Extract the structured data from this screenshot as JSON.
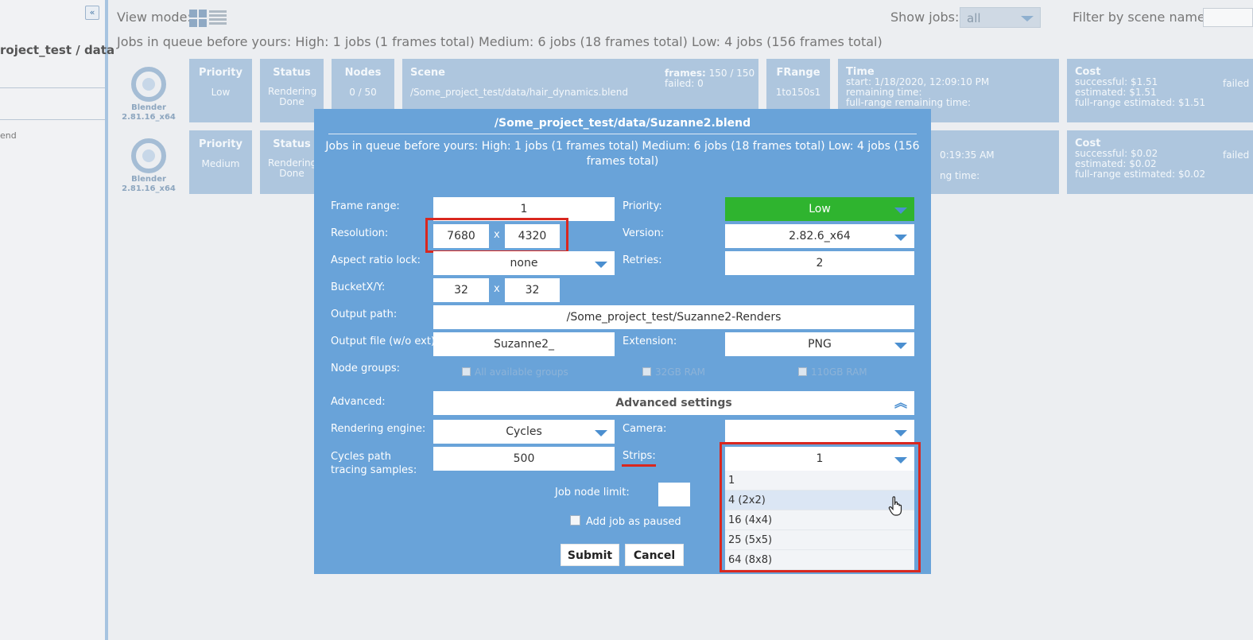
{
  "sidebar": {
    "collapse_glyph": "«",
    "breadcrumb": "roject_test / data",
    "end_text": "end"
  },
  "topbar": {
    "view_mode_label": "View mode:",
    "show_jobs_label": "Show jobs:",
    "show_jobs_value": "all",
    "filter_label": "Filter by scene name:",
    "filter_value": "",
    "queue_summary": "Jobs in queue before yours: High: 1 jobs (1 frames total)  Medium: 6 jobs (18 frames total)  Low: 4 jobs (156 frames total)"
  },
  "jobs": [
    {
      "app": "Blender",
      "app_version": "2.81.16_x64",
      "priority_label": "Priority",
      "priority": "Low",
      "status_label": "Status",
      "status": "Rendering Done",
      "nodes_label": "Nodes",
      "nodes": "0 / 50",
      "scene_label": "Scene",
      "scene": "/Some_project_test/data/hair_dynamics.blend",
      "frames_label": "frames:",
      "frames": "150 / 150",
      "failed_label": "failed:",
      "failed": "0",
      "frange_label": "FRange",
      "frange": "1to150s1",
      "time_label": "Time",
      "time_start": "start: 1/18/2020, 12:09:10 PM",
      "time_remaining": "remaining time:",
      "time_full": "full-range remaining time:",
      "cost_label": "Cost",
      "cost_successful": "successful: $1.51",
      "cost_estimated": "estimated: $1.51",
      "cost_full": "full-range estimated: $1.51",
      "cost_failed": "failed"
    },
    {
      "app": "Blender",
      "app_version": "2.81.16_x64",
      "priority_label": "Priority",
      "priority": "Medium",
      "status_label": "Status",
      "status": "Rendering Done",
      "time_partial_1": "0:19:35 AM",
      "time_partial_2": "ng time:",
      "cost_label": "Cost",
      "cost_successful": "successful: $0.02",
      "cost_estimated": "estimated: $0.02",
      "cost_full": "full-range estimated: $0.02",
      "cost_failed": "failed"
    }
  ],
  "modal": {
    "title": "/Some_project_test/data/Suzanne2.blend",
    "queue_text": "Jobs in queue before yours: High: 1 jobs (1 frames total)  Medium: 6 jobs (18 frames total)  Low: 4 jobs (156 frames total)",
    "frame_range_label": "Frame range:",
    "frame_range": "1",
    "resolution_label": "Resolution:",
    "res_x": "7680",
    "res_y": "4320",
    "x_sep": "x",
    "aspect_label": "Aspect ratio lock:",
    "aspect": "none",
    "bucket_label": "BucketX/Y:",
    "bucket_x": "32",
    "bucket_y": "32",
    "output_path_label": "Output path:",
    "output_path": "/Some_project_test/Suzanne2-Renders",
    "output_file_label": "Output file (w/o ext):",
    "output_file": "Suzanne2_",
    "node_groups_label": "Node groups:",
    "node_groups": [
      "All available groups",
      "32GB RAM",
      "110GB RAM"
    ],
    "advanced_label": "Advanced:",
    "advanced_button": "Advanced settings",
    "engine_label": "Rendering engine:",
    "engine": "Cycles",
    "samples_label": "Cycles path tracing samples:",
    "samples": "500",
    "job_node_limit_label": "Job node limit:",
    "job_node_limit": "",
    "add_paused_label": "Add job as paused",
    "priority_label": "Priority:",
    "priority": "Low",
    "priority_color": "#2fb42f",
    "version_label": "Version:",
    "version": "2.82.6_x64",
    "retries_label": "Retries:",
    "retries": "2",
    "extension_label": "Extension:",
    "extension": "PNG",
    "camera_label": "Camera:",
    "camera": "",
    "strips_label": "Strips:",
    "strips": "1",
    "strips_options": [
      "1",
      "4 (2x2)",
      "16 (4x4)",
      "25 (5x5)",
      "64 (8x8)"
    ],
    "strips_hover_index": 1,
    "submit": "Submit",
    "cancel": "Cancel",
    "highlight_color": "#d9271f"
  }
}
